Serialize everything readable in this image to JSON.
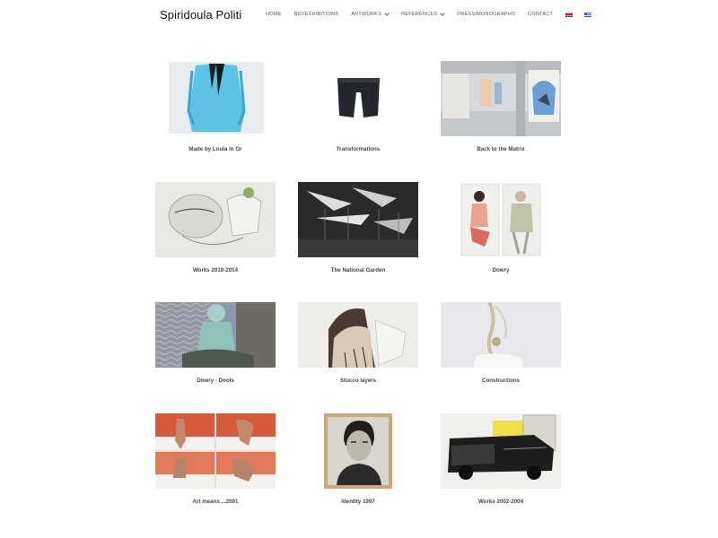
{
  "site": {
    "title": "Spiridoula Politi"
  },
  "nav": [
    {
      "label": "HOME",
      "dropdown": false
    },
    {
      "label": "BIO/EXHIBITIONS",
      "dropdown": false
    },
    {
      "label": "ARTWORKS",
      "dropdown": true
    },
    {
      "label": "REFERENCES",
      "dropdown": true
    },
    {
      "label": "PRESS/MONOGRAPHS",
      "dropdown": false
    },
    {
      "label": "CONTACT",
      "dropdown": false
    }
  ],
  "languages": [
    {
      "code": "en",
      "icon": "uk-flag-icon"
    },
    {
      "code": "el",
      "icon": "greek-flag-icon"
    }
  ],
  "gallery": [
    {
      "caption": "Made by Loula in Gr"
    },
    {
      "caption": "Transformations"
    },
    {
      "caption": "Back to the Matrix"
    },
    {
      "caption": "Works 2010-2014"
    },
    {
      "caption": "The National Garden"
    },
    {
      "caption": "Dowry"
    },
    {
      "caption": "Dowry - Dools"
    },
    {
      "caption": "Stucco layers"
    },
    {
      "caption": "Constructions"
    },
    {
      "caption": "Art means ...2001"
    },
    {
      "caption": "Identity 1997"
    },
    {
      "caption": "Works 2002-2004"
    }
  ]
}
